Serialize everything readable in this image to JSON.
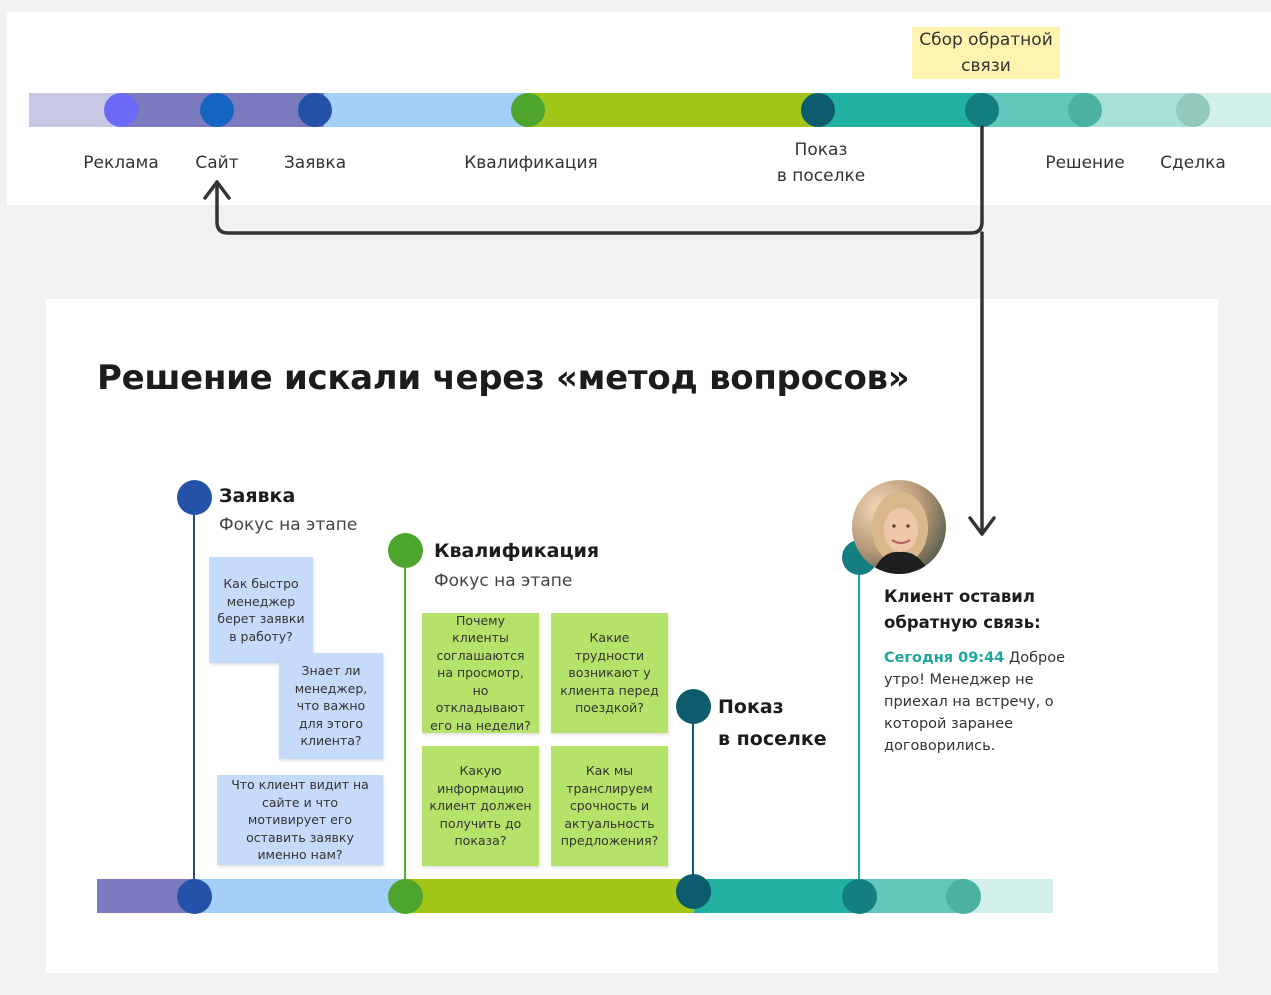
{
  "top_timeline": {
    "segment_colors": [
      "#c8c8e6",
      "#7b7cc0",
      "#a3cff8",
      "#a2c617",
      "#22b0a0",
      "#62c8bc",
      "#a7e0d7",
      "#d2efec"
    ],
    "stages": [
      {
        "label": "Реклама",
        "color": "#6a6af7"
      },
      {
        "label": "Сайт",
        "color": "#1565c0"
      },
      {
        "label": "Заявка",
        "color": "#2452a8"
      },
      {
        "label": "Квалификация",
        "color": "#4ea52e"
      },
      {
        "label": "Показ\nв поселке",
        "color": "#0d5c6e"
      },
      {
        "label": "",
        "color": "#147f80"
      },
      {
        "label": "Решение",
        "color": "#4bb1a2"
      },
      {
        "label": "Сделка",
        "color": "#93c9bd"
      }
    ],
    "feedback_tag": "Сбор обратной\nсвязи",
    "arrow_color": "#333333"
  },
  "main": {
    "title": "Решение искали через «метод вопросов»",
    "stages": {
      "application": {
        "title": "Заявка",
        "subtitle": "Фокус на этапе",
        "color": "#2452a8",
        "line_color": "#1e4d78"
      },
      "qualification": {
        "title": "Квалификация",
        "subtitle": "Фокус на этапе",
        "color": "#4ea52e",
        "line_color": "#5aae2d"
      },
      "showing": {
        "title": "Показ\nв поселке",
        "color": "#0d5c6e",
        "line_color": "#0d5c6e"
      },
      "feedback": {
        "color": "#147f80",
        "line_color": "#1aa89a"
      }
    },
    "blue_stickies": [
      "Как быстро менеджер берет заявки в работу?",
      "Знает ли менеджер, что важно для этого клиента?",
      "Что клиент видит на сайте и что  мотивирует его оставить заявку именно нам?"
    ],
    "green_stickies": [
      "Почему клиенты соглашаются на просмотр, но откладывают его на недели?",
      "Какие трудности возникают у клиента перед поездкой?",
      "Какую информацию клиент должен получить до показа?",
      "Как мы транслируем срочность и актуальность предложения?"
    ],
    "client": {
      "heading": "Клиент оставил\nобратную связь:",
      "time": "Сегодня 09:44",
      "message": " Доброе утро! Менеджер не приехал на встречу, о которой заранее договорились."
    },
    "bottom_segment_colors": [
      "#7b7cc0",
      "#a3cff8",
      "#a2c617",
      "#22b0a0",
      "#62c8bc",
      "#d2efec"
    ]
  }
}
